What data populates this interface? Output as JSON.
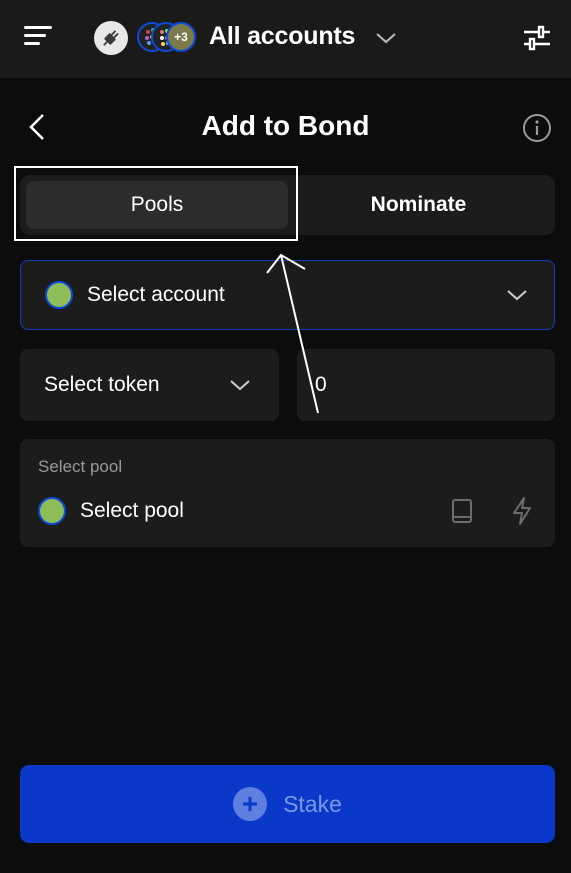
{
  "header": {
    "account_title": "All accounts",
    "extra_accounts_badge": "+3",
    "icons": [
      "menu-icon",
      "plug-icon",
      "chevron-down-icon",
      "sliders-icon"
    ]
  },
  "page": {
    "title": "Add to Bond",
    "icons": [
      "back-icon",
      "info-icon"
    ]
  },
  "tabs": [
    {
      "label": "Pools",
      "active": true
    },
    {
      "label": "Nominate",
      "active": false
    }
  ],
  "form": {
    "account_select_label": "Select account",
    "token_select_label": "Select token",
    "amount_value": "0",
    "pool_caption": "Select pool",
    "pool_select_label": "Select pool"
  },
  "actions": {
    "stake_label": "Stake"
  },
  "colors": {
    "background": "#0c0c0c",
    "surface": "#1c1c1c",
    "primary": "#0a38c8",
    "account_border": "#0e3fb8"
  }
}
